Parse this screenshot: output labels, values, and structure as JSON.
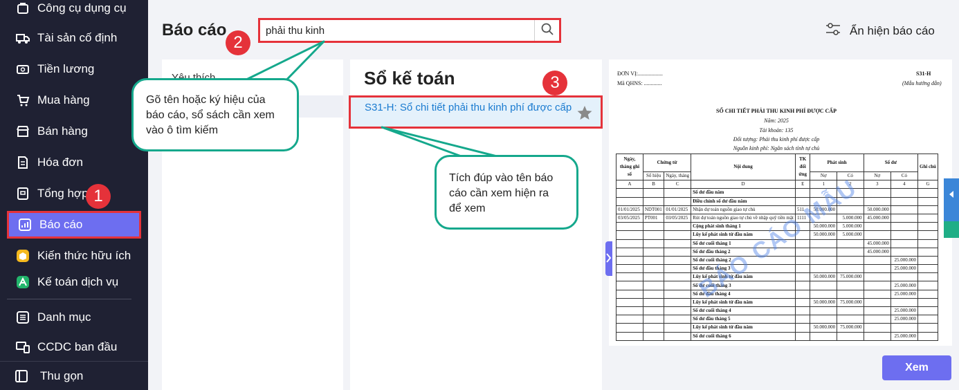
{
  "sidebar": {
    "items": [
      {
        "label": "Công cụ dụng cụ",
        "icon": "tools-icon"
      },
      {
        "label": "Tài sản cố định",
        "icon": "truck-icon"
      },
      {
        "label": "Tiền lương",
        "icon": "salary-icon"
      },
      {
        "label": "Mua hàng",
        "icon": "cart-icon"
      },
      {
        "label": "Bán hàng",
        "icon": "store-icon"
      },
      {
        "label": "Hóa đơn",
        "icon": "invoice-icon"
      },
      {
        "label": "Tổng hợp",
        "icon": "summary-icon"
      },
      {
        "label": "Báo cáo",
        "icon": "chart-icon"
      },
      {
        "label": "Kiến thức hữu ích",
        "icon": "knowledge-icon"
      },
      {
        "label": "Kế toán dịch vụ",
        "icon": "service-icon"
      },
      {
        "label": "Danh mục",
        "icon": "list-icon"
      },
      {
        "label": "CCDC ban đầu",
        "icon": "devices-icon"
      }
    ],
    "collapse_label": "Thu gọn"
  },
  "header": {
    "title": "Báo cáo",
    "search_value": "phải thu kinh",
    "toggle_label": "Ẩn hiện báo cáo"
  },
  "left_panel": {
    "favorites_label": "Yêu thích"
  },
  "middle_panel": {
    "section_title": "Sổ kế toán",
    "report_item": "S31-H: Sổ chi tiết phải thu kinh phí được cấp"
  },
  "callouts": {
    "badge1": "1",
    "badge2": "2",
    "badge3": "3",
    "bubble_search": "Gõ tên hoặc ký hiệu của báo cáo, sổ sách cần xem vào ô tìm kiếm",
    "bubble_open": "Tích đúp vào tên báo cáo cần xem hiện ra để xem"
  },
  "preview": {
    "unit": "ĐƠN VỊ:..................",
    "qhns": "Mã QHNS: .............",
    "form_code": "S31-H",
    "form_note": "(Mẫu hướng dẫn)",
    "title": "SỔ CHI TIẾT PHẢI THU KINH PHÍ ĐƯỢC CẤP",
    "year": "Năm: 2025",
    "account": "Tài khoản: 135",
    "object": "Đối tượng: Phải thu kinh phí được cấp",
    "source": "Nguồn kinh phí: Ngân sách tỉnh tự chủ",
    "watermark": "BÁO CÁO MẪU",
    "headers": [
      "Ngày, tháng ghi sổ",
      "Chứng từ",
      "Nội dung",
      "TK đối ứng",
      "Phát sinh",
      "Số dư",
      "Ghi chú"
    ],
    "subheaders": [
      "Số hiệu",
      "Ngày, tháng",
      "Nợ",
      "Có",
      "Nợ",
      "Có"
    ],
    "letters": [
      "A",
      "B",
      "C",
      "D",
      "E",
      "1",
      "2",
      "3",
      "4",
      "G"
    ],
    "rows": [
      [
        "",
        "",
        "",
        "Số dư đầu năm",
        "",
        "",
        "",
        "",
        "",
        ""
      ],
      [
        "",
        "",
        "",
        "Điều chỉnh số dư đầu năm",
        "",
        "",
        "",
        "",
        "",
        ""
      ],
      [
        "01/01/2025",
        "NDT001",
        "01/01/2025",
        "Nhận dự toán nguồn giao tự chủ",
        "511",
        "50.000.000",
        "",
        "50.000.000",
        "",
        ""
      ],
      [
        "03/05/2025",
        "PT001",
        "03/05/2025",
        "Rút dự toán nguồn giao tự chủ về nhập quỹ tiền mặt",
        "1111",
        "",
        "5.000.000",
        "45.000.000",
        "",
        ""
      ],
      [
        "",
        "",
        "",
        "Cộng phát sinh tháng 1",
        "",
        "50.000.000",
        "5.000.000",
        "",
        "",
        ""
      ],
      [
        "",
        "",
        "",
        "Lũy kế phát sinh từ đầu năm",
        "",
        "50.000.000",
        "5.000.000",
        "",
        "",
        ""
      ],
      [
        "",
        "",
        "",
        "Số dư cuối tháng 1",
        "",
        "",
        "",
        "45.000.000",
        "",
        ""
      ],
      [
        "",
        "",
        "",
        "Số dư đầu tháng 2",
        "",
        "",
        "",
        "45.000.000",
        "",
        ""
      ],
      [
        "",
        "",
        "",
        "Số dư cuối tháng 2",
        "",
        "",
        "",
        "",
        "25.000.000",
        ""
      ],
      [
        "",
        "",
        "",
        "Số dư đầu tháng 3",
        "",
        "",
        "",
        "",
        "25.000.000",
        ""
      ],
      [
        "",
        "",
        "",
        "Lũy kế phát sinh từ đầu năm",
        "",
        "50.000.000",
        "75.000.000",
        "",
        "",
        ""
      ],
      [
        "",
        "",
        "",
        "Số dư cuối tháng 3",
        "",
        "",
        "",
        "",
        "25.000.000",
        ""
      ],
      [
        "",
        "",
        "",
        "Số dư đầu tháng 4",
        "",
        "",
        "",
        "",
        "25.000.000",
        ""
      ],
      [
        "",
        "",
        "",
        "Lũy kế phát sinh từ đầu năm",
        "",
        "50.000.000",
        "75.000.000",
        "",
        "",
        ""
      ],
      [
        "",
        "",
        "",
        "Số dư cuối tháng 4",
        "",
        "",
        "",
        "",
        "25.000.000",
        ""
      ],
      [
        "",
        "",
        "",
        "Số dư đầu tháng 5",
        "",
        "",
        "",
        "",
        "25.000.000",
        ""
      ],
      [
        "",
        "",
        "",
        "Lũy kế phát sinh từ đầu năm",
        "",
        "50.000.000",
        "75.000.000",
        "",
        "",
        ""
      ],
      [
        "",
        "",
        "",
        "Số dư cuối tháng 6",
        "",
        "",
        "",
        "",
        "25.000.000",
        ""
      ]
    ]
  },
  "view_button": "Xem",
  "colors": {
    "sidebar": "#1f2133",
    "accent": "#6d6ef0",
    "highlight": "#e5323a",
    "bubble_border": "#15a88c",
    "link": "#1a7bd0"
  }
}
